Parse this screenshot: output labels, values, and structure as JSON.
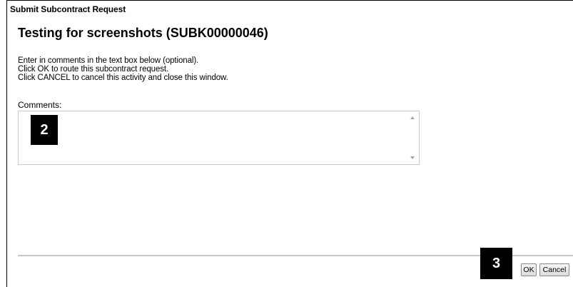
{
  "window": {
    "title": "Submit Subcontract Request"
  },
  "main": {
    "heading": "Testing for screenshots (SUBK00000046)",
    "instructions": [
      "Enter in comments in the text box below (optional).",
      "Click OK to route this subcontract request.",
      "Click CANCEL to cancel this activity and close this window."
    ],
    "comments_label": "Comments:",
    "comments_value": ""
  },
  "callouts": {
    "step_2": "2",
    "step_3": "3"
  },
  "footer": {
    "ok_label": "OK",
    "cancel_label": "Cancel"
  },
  "icons": {
    "scroll_up": "scroll-up-arrow-icon",
    "scroll_down": "scroll-down-arrow-icon"
  }
}
